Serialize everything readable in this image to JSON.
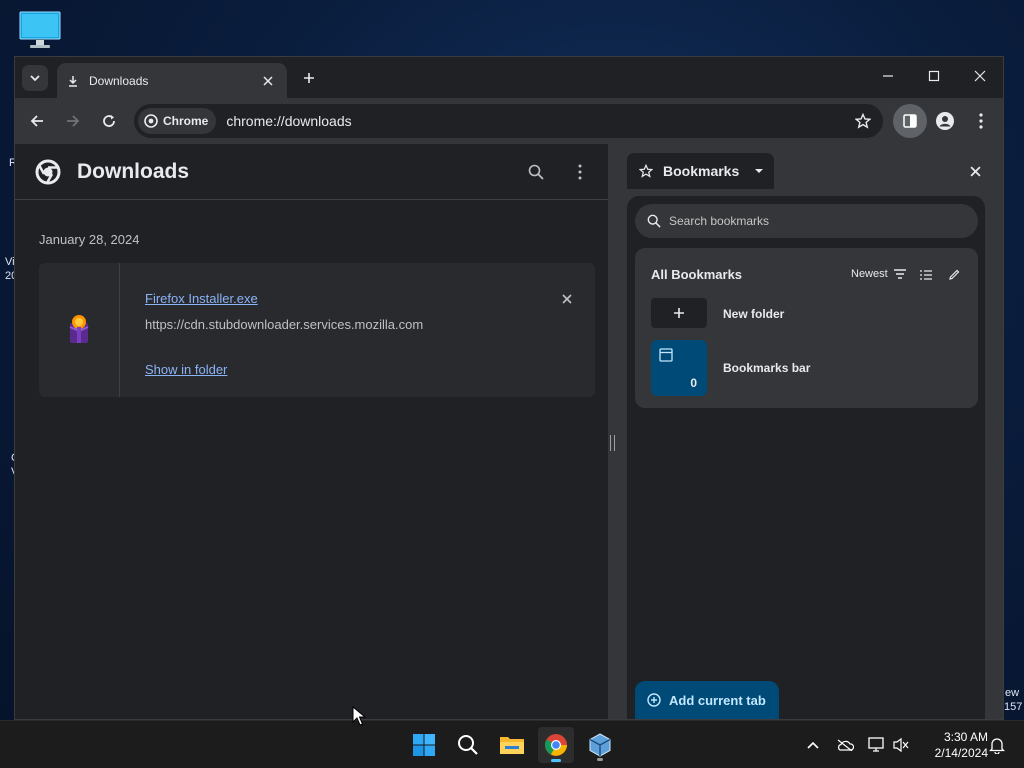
{
  "desktop": {
    "icon_name": "monitor-icon",
    "edge_fragments": [
      "R",
      "Vi",
      "20",
      "C",
      "V",
      "ew",
      "157"
    ]
  },
  "browser": {
    "tab": {
      "title": "Downloads",
      "icon": "download-icon"
    },
    "window_controls": [
      "minimize",
      "maximize",
      "close"
    ],
    "omnibox": {
      "chip_label": "Chrome",
      "url": "chrome://downloads"
    }
  },
  "downloads": {
    "title": "Downloads",
    "date": "January 28, 2024",
    "item": {
      "filename": "Firefox Installer.exe",
      "url": "https://cdn.stubdownloader.services.mozilla.com",
      "action": "Show in folder"
    }
  },
  "bookmarks_panel": {
    "title": "Bookmarks",
    "search_placeholder": "Search bookmarks",
    "section_title": "All Bookmarks",
    "sort_label": "Newest",
    "new_folder_label": "New folder",
    "folders": [
      {
        "name": "Bookmarks bar",
        "count": "0"
      }
    ],
    "add_button": "Add current tab"
  },
  "taskbar": {
    "apps": [
      "start",
      "search",
      "file-explorer",
      "chrome",
      "virtualbox"
    ],
    "time": "3:30 AM",
    "date": "2/14/2024"
  },
  "colors": {
    "accent": "#004a77",
    "link": "#8ab4f8",
    "taskbar_indicator": "#4cc2ff"
  }
}
